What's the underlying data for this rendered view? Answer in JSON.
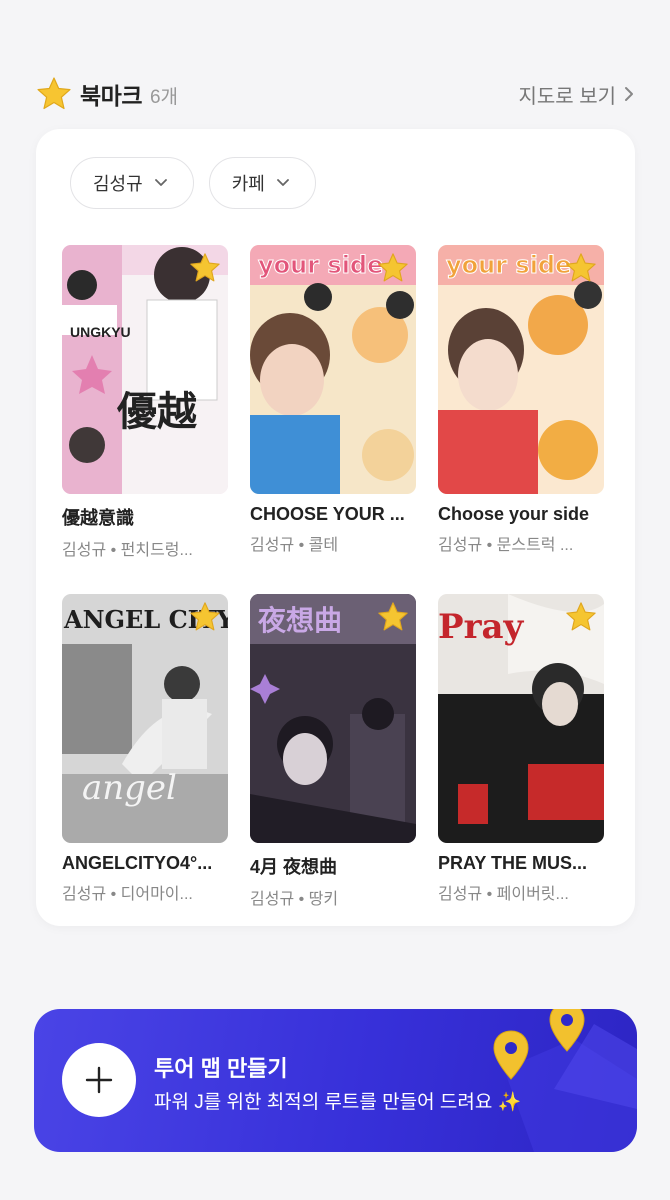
{
  "header": {
    "title": "북마크",
    "count": "6개",
    "map_link": "지도로 보기"
  },
  "filters": [
    {
      "label": "김성규"
    },
    {
      "label": "카페"
    }
  ],
  "items": [
    {
      "title": "優越意識",
      "subtitle": "김성규 • 펀치드렁...",
      "thumb_text": "優越"
    },
    {
      "title": "CHOOSE YOUR ...",
      "subtitle": "김성규 • 콜테",
      "thumb_text": "your side"
    },
    {
      "title": "Choose your side",
      "subtitle": "김성규 • 문스트럭 ...",
      "thumb_text": "your side"
    },
    {
      "title": "ANGELCITYO4°...",
      "subtitle": "김성규 • 디어마이...",
      "thumb_text": "ANGEL CITY"
    },
    {
      "title": "4月 夜想曲",
      "subtitle": "김성규 • 땅키",
      "thumb_text": "夜想曲"
    },
    {
      "title": "PRAY THE MUS...",
      "subtitle": "김성규 • 페이버릿...",
      "thumb_text": "Pray"
    }
  ],
  "banner": {
    "title": "투어 맵 만들기",
    "subtitle": "파워 J를 위한 최적의 루트를 만들어 드려요 ✨"
  },
  "colors": {
    "banner": "#3a33d8",
    "star": "#f5c531",
    "pin": "#f2c12e"
  }
}
